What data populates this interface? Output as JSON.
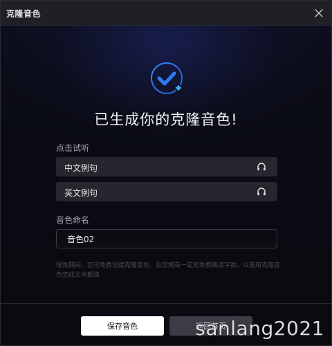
{
  "dialog": {
    "title": "克隆音色",
    "close_icon": "close-icon"
  },
  "success": {
    "icon": "check-circle-sparkle-icon",
    "headline": "已生成你的克隆音色!"
  },
  "listen": {
    "label": "点击试听",
    "samples": [
      {
        "label": "中文例句",
        "icon": "headphones-icon"
      },
      {
        "label": "英文例句",
        "icon": "headphones-icon"
      }
    ]
  },
  "naming": {
    "label": "音色命名",
    "value": "音色02"
  },
  "note": "限免期间，您可免费创建克隆音色，且您拥有一定的免费朗读字数，以使用克隆音色完成文本朗读",
  "footer": {
    "save_label": "保存音色",
    "return_label": "返回首页"
  },
  "watermark": "sanlang2021",
  "colors": {
    "accent": "#2f7cf6",
    "sparkle": "#4aa6ff",
    "ring": "#2c6fd8"
  }
}
